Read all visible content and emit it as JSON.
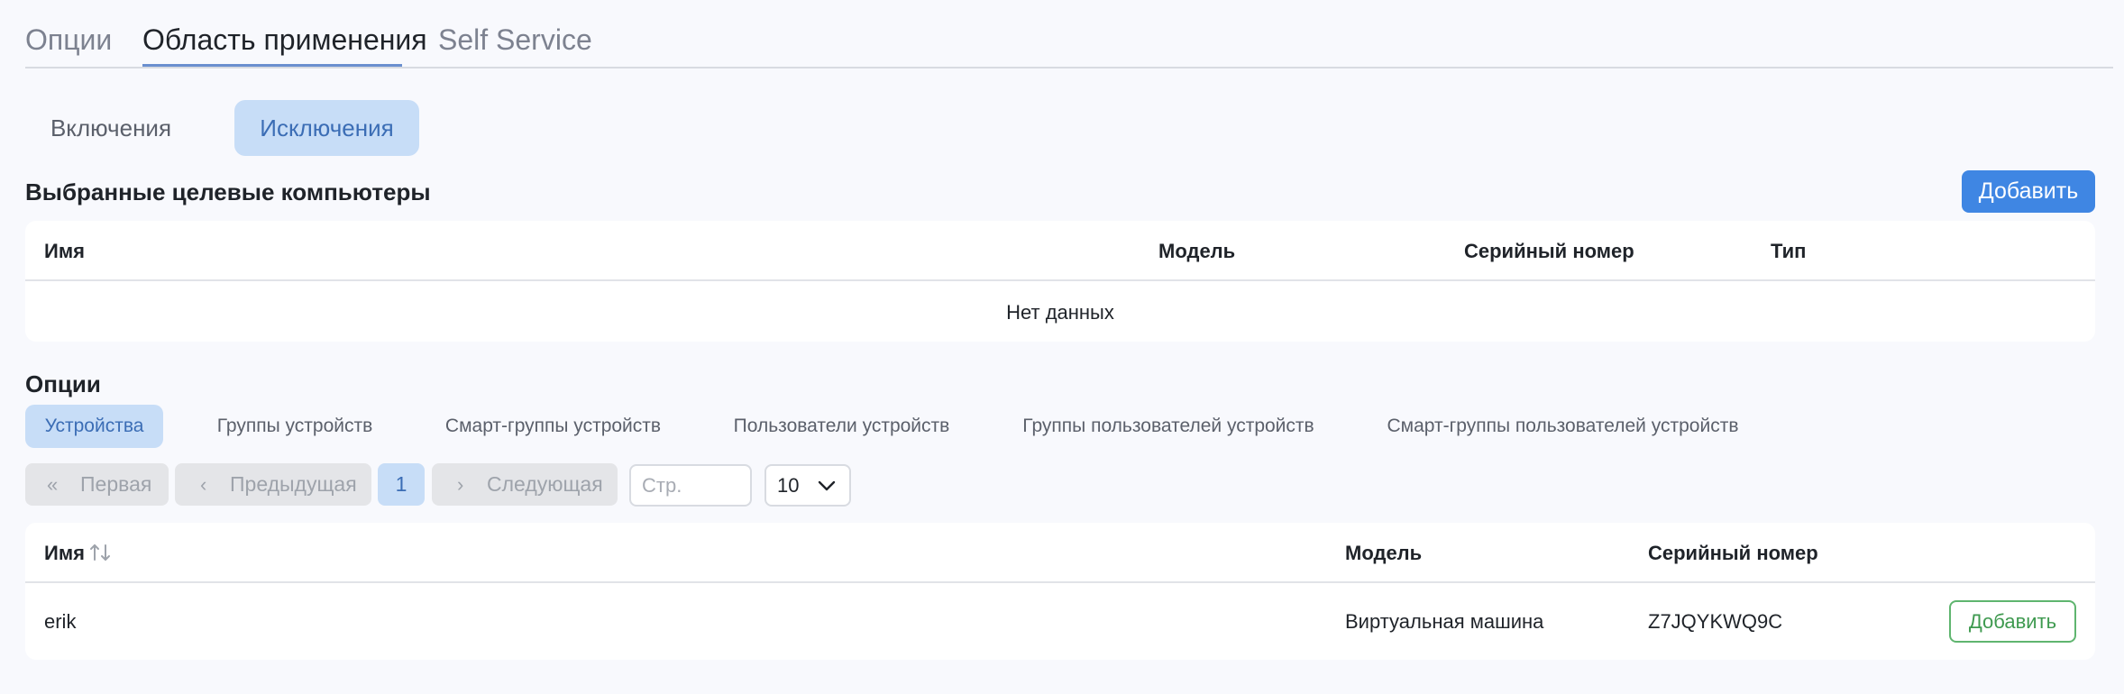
{
  "top_tabs": [
    {
      "label": "Опции"
    },
    {
      "label": "Область применения"
    },
    {
      "label": "Self Service"
    }
  ],
  "active_top_tab": "Область применения",
  "sub_tabs": [
    {
      "label": "Включения"
    },
    {
      "label": "Исключения"
    }
  ],
  "active_sub_tab": "Исключения",
  "targets": {
    "title": "Выбранные целевые компьютеры",
    "add_label": "Добавить",
    "columns": [
      "Имя",
      "Модель",
      "Серийный номер",
      "Тип"
    ],
    "empty_text": "Нет данных"
  },
  "options": {
    "title": "Опции",
    "chips": [
      {
        "label": "Устройства"
      },
      {
        "label": "Группы устройств"
      },
      {
        "label": "Смарт-группы устройств"
      },
      {
        "label": "Пользователи устройств"
      },
      {
        "label": "Группы пользователей устройств"
      },
      {
        "label": "Смарт-группы пользователей устройств"
      }
    ],
    "active_chip": "Устройства"
  },
  "pagination": {
    "first_label": "Первая",
    "prev_label": "Предыдущая",
    "current_page": "1",
    "next_label": "Следующая",
    "page_placeholder": "Стр.",
    "page_size": "10"
  },
  "devices": {
    "columns": [
      "Имя",
      "Модель",
      "Серийный номер"
    ],
    "rows": [
      {
        "name": "erik",
        "model": "Виртуальная машина",
        "serial": "Z7JQYKWQ9C",
        "action_label": "Добавить"
      }
    ]
  },
  "colors": {
    "accent": "#3f86e3",
    "active_chip_bg": "#c7ddf7",
    "add_outline": "#5fb56f",
    "background": "#f8f9fd"
  }
}
